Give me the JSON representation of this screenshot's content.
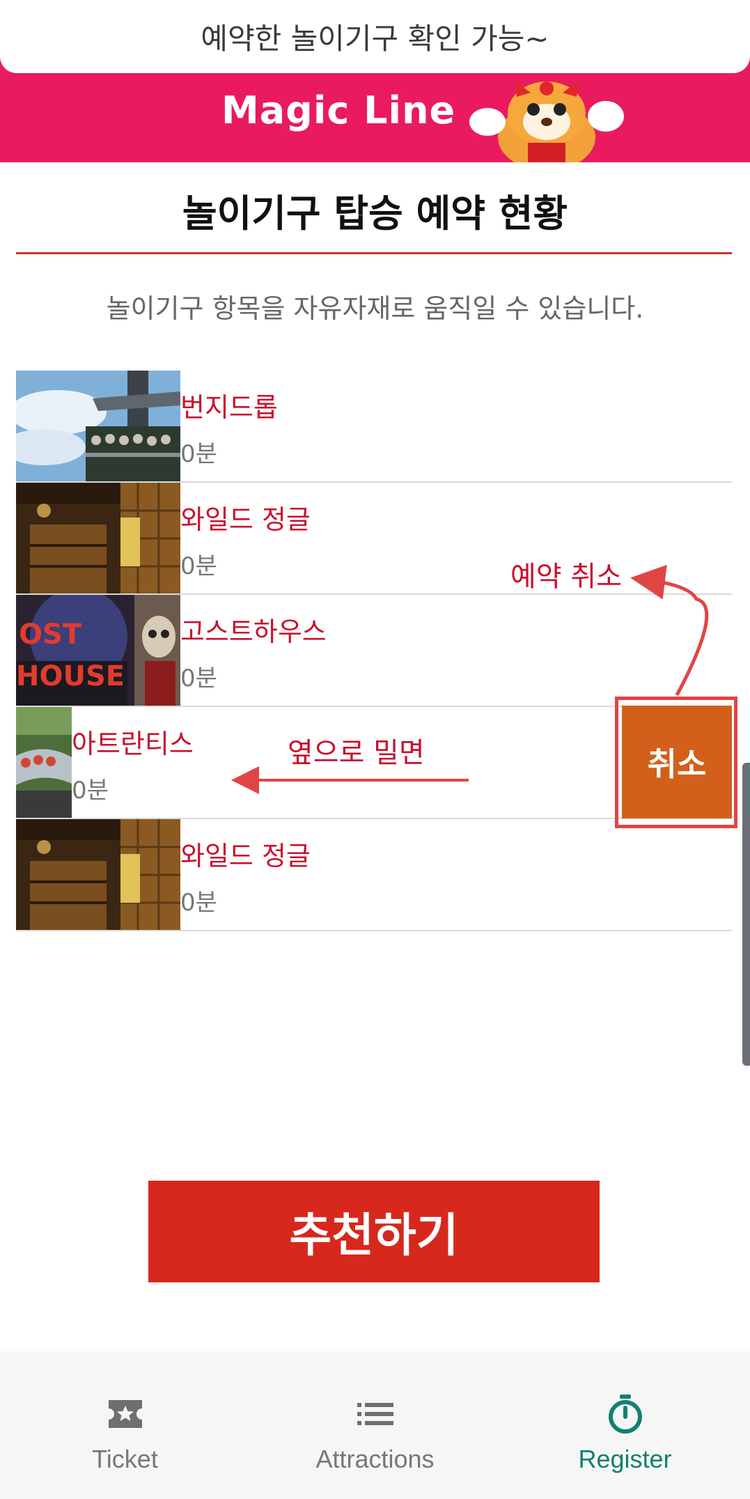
{
  "top_caption": "예약한 놀이기구 확인 가능~",
  "banner": {
    "brand": "Magic Line",
    "background": "#e91b5e"
  },
  "page_title": "놀이기구 탑승 예약 현황",
  "subtitle": "놀이기구 항목을 자유자재로 움직일 수 있습니다.",
  "rides": [
    {
      "name": "번지드롭",
      "wait": "0분",
      "thumb": "drop-tower"
    },
    {
      "name": "와일드 정글",
      "wait": "0분",
      "thumb": "wooden-hall"
    },
    {
      "name": "고스트하우스",
      "wait": "0분",
      "thumb": "ghost-house"
    },
    {
      "name": "아트란티스",
      "wait": "0분",
      "thumb": "coaster"
    },
    {
      "name": "와일드 정글",
      "wait": "0분",
      "thumb": "wooden-hall"
    }
  ],
  "swipe_action": {
    "label": "취소",
    "color": "#d2601a"
  },
  "annotations": {
    "cancel": "예약 취소",
    "swipe": "옆으로 밀면"
  },
  "recommend_button": "추천하기",
  "nav": [
    {
      "label": "Ticket",
      "icon": "ticket-star-icon",
      "active": false
    },
    {
      "label": "Attractions",
      "icon": "list-icon",
      "active": false
    },
    {
      "label": "Register",
      "icon": "stopwatch-icon",
      "active": true
    }
  ],
  "colors": {
    "accent": "#c8102e",
    "active_tab": "#12806f",
    "button": "#d7281e"
  }
}
